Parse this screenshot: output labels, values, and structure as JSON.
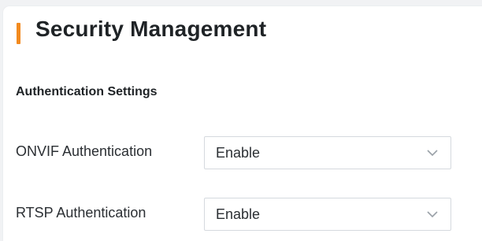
{
  "header": {
    "title": "Security Management",
    "accent_color": "#f28a1f"
  },
  "auth_settings": {
    "section_title": "Authentication Settings",
    "fields": [
      {
        "label": "ONVIF Authentication",
        "value": "Enable",
        "icon": "chevron-down-icon"
      },
      {
        "label": "RTSP Authentication",
        "value": "Enable",
        "icon": "chevron-down-icon"
      }
    ]
  }
}
